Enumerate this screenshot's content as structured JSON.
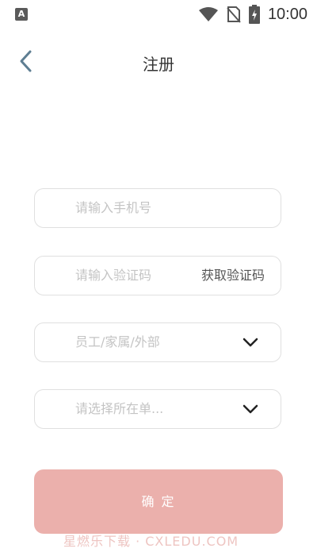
{
  "status_bar": {
    "app_icon_letter": "A",
    "time": "10:00"
  },
  "header": {
    "title": "注册"
  },
  "form": {
    "phone_placeholder": "请输入手机号",
    "code_placeholder": "请输入验证码",
    "get_code_label": "获取验证码",
    "role_select": "员工/家属/外部",
    "unit_select": "请选择所在单..."
  },
  "confirm_label": "确 定",
  "watermark": "星燃乐下载 · CXLEDU.COM",
  "colors": {
    "accent": "#ebb0ac",
    "back_icon": "#5e7e92"
  },
  "icons": {
    "back": "chevron-left-icon",
    "wifi": "wifi-icon",
    "sim": "no-sim-icon",
    "battery": "battery-charging-icon",
    "dropdown": "chevron-down-icon"
  }
}
